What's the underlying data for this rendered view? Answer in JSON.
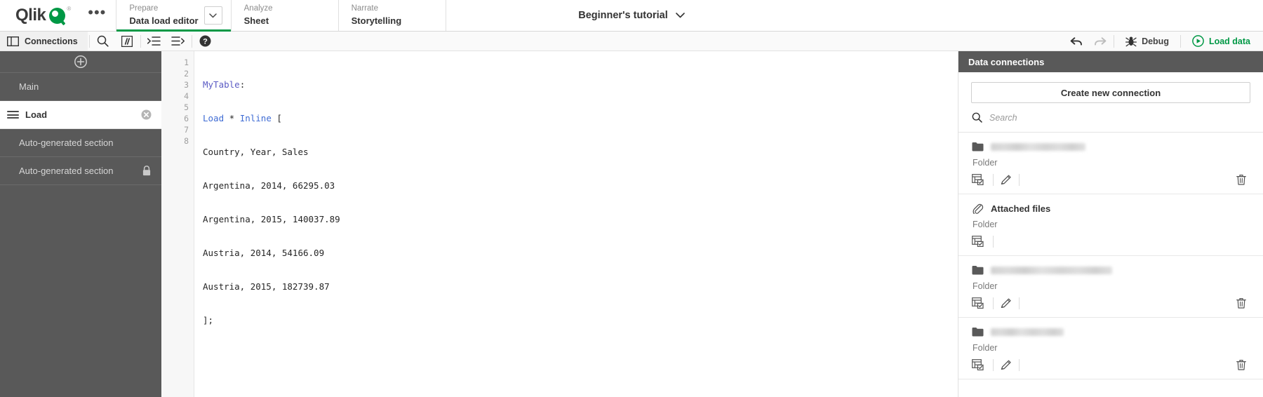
{
  "brand": {
    "name": "Qlik",
    "trademark": "®",
    "overflow_menu": "•••"
  },
  "topnav": {
    "items": [
      {
        "kicker": "Prepare",
        "label": "Data load editor",
        "active": true,
        "has_chevron": true
      },
      {
        "kicker": "Analyze",
        "label": "Sheet",
        "active": false,
        "has_chevron": false
      },
      {
        "kicker": "Narrate",
        "label": "Storytelling",
        "active": false,
        "has_chevron": false
      }
    ],
    "app_title": "Beginner's tutorial"
  },
  "toolbar": {
    "connections_label": "Connections",
    "search_tooltip": "Search",
    "comment_tooltip": "Comment",
    "indent_tooltip": "Indent",
    "outdent_tooltip": "Outdent",
    "help_tooltip": "Help",
    "undo_tooltip": "Undo",
    "redo_tooltip": "Redo",
    "debug_label": "Debug",
    "load_data_label": "Load data",
    "accent_color": "#009845"
  },
  "sidebar": {
    "add_tooltip": "Add section",
    "sections": [
      {
        "label": "Main",
        "selected": false,
        "locked": false,
        "closable": false
      },
      {
        "label": "Load",
        "selected": true,
        "locked": false,
        "closable": true
      },
      {
        "label": "Auto-generated section",
        "selected": false,
        "locked": false,
        "closable": false
      },
      {
        "label": "Auto-generated section",
        "selected": false,
        "locked": true,
        "closable": false
      }
    ]
  },
  "editor": {
    "line_numbers": [
      "1",
      "2",
      "3",
      "4",
      "5",
      "6",
      "7",
      "8"
    ],
    "lines": [
      {
        "segments": [
          {
            "text": "MyTable",
            "type": "ident"
          },
          {
            "text": ":",
            "type": "plain"
          }
        ]
      },
      {
        "segments": [
          {
            "text": "Load",
            "type": "kw"
          },
          {
            "text": " * ",
            "type": "plain"
          },
          {
            "text": "Inline",
            "type": "kw"
          },
          {
            "text": " [",
            "type": "plain"
          }
        ]
      },
      {
        "segments": [
          {
            "text": "Country, Year, Sales",
            "type": "plain"
          }
        ]
      },
      {
        "segments": [
          {
            "text": "Argentina, 2014, 66295.03",
            "type": "plain"
          }
        ]
      },
      {
        "segments": [
          {
            "text": "Argentina, 2015, 140037.89",
            "type": "plain"
          }
        ]
      },
      {
        "segments": [
          {
            "text": "Austria, 2014, 54166.09",
            "type": "plain"
          }
        ]
      },
      {
        "segments": [
          {
            "text": "Austria, 2015, 182739.87",
            "type": "plain"
          }
        ]
      },
      {
        "segments": [
          {
            "text": "];",
            "type": "plain"
          }
        ]
      }
    ]
  },
  "data_connections": {
    "title": "Data connections",
    "create_button": "Create new connection",
    "search_placeholder": "Search",
    "items": [
      {
        "name": "",
        "name_hidden": true,
        "name_width": 135,
        "type": "Folder",
        "icon": "folder-icon",
        "actions": {
          "select_data": true,
          "edit": true,
          "delete": true
        }
      },
      {
        "name": "Attached files",
        "name_hidden": false,
        "name_width": 0,
        "type": "Folder",
        "icon": "paperclip-icon",
        "actions": {
          "select_data": true,
          "edit": false,
          "delete": false
        }
      },
      {
        "name": "",
        "name_hidden": true,
        "name_width": 173,
        "type": "Folder",
        "icon": "folder-icon",
        "actions": {
          "select_data": true,
          "edit": true,
          "delete": true
        }
      },
      {
        "name": "",
        "name_hidden": true,
        "name_width": 104,
        "type": "Folder",
        "icon": "folder-icon",
        "actions": {
          "select_data": true,
          "edit": true,
          "delete": true
        }
      }
    ],
    "action_labels": {
      "select_data": "Select data",
      "edit": "Edit",
      "delete": "Delete"
    }
  }
}
